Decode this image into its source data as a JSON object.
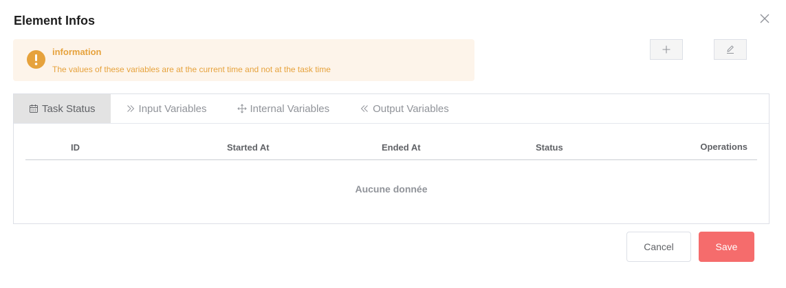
{
  "dialog": {
    "title": "Element Infos"
  },
  "alert": {
    "title": "information",
    "description": "The values of these variables are at the current time and not at the task time",
    "color": "#e6a23c",
    "background": "#fdf4ea"
  },
  "toolbar": {
    "add_icon": "plus-icon",
    "edit_icon": "edit-icon"
  },
  "tabs": [
    {
      "label": "Task Status",
      "icon": "calendar-icon",
      "active": true
    },
    {
      "label": "Input Variables",
      "icon": "chevron-double-right-icon",
      "active": false
    },
    {
      "label": "Internal Variables",
      "icon": "move-icon",
      "active": false
    },
    {
      "label": "Output Variables",
      "icon": "chevron-double-left-icon",
      "active": false
    }
  ],
  "table": {
    "columns": [
      "ID",
      "Started At",
      "Ended At",
      "Status",
      "Operations"
    ],
    "empty_text": "Aucune donnée"
  },
  "footer": {
    "cancel_label": "Cancel",
    "save_label": "Save",
    "save_color": "#f56c6c"
  }
}
